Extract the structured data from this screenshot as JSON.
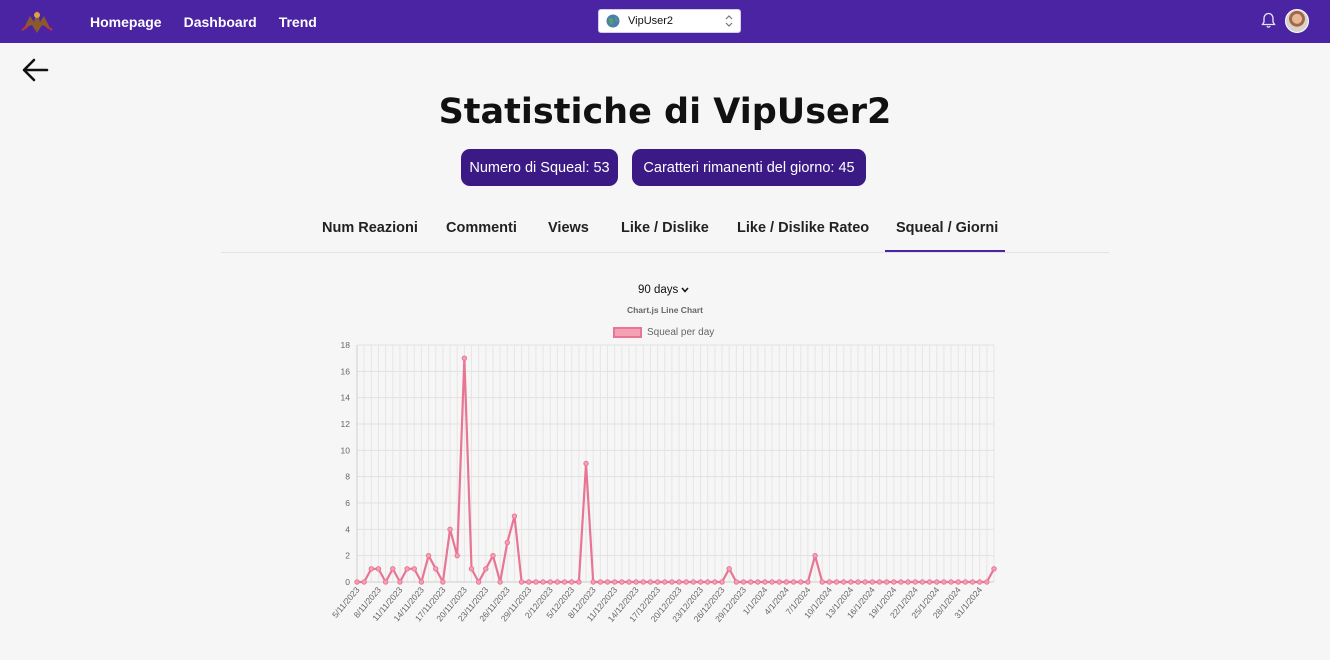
{
  "nav": {
    "links": [
      "Homepage",
      "Dashboard",
      "Trend"
    ],
    "selected_user": "VipUser2"
  },
  "page": {
    "title": "Statistiche di VipUser2",
    "squeal_count_label": "Numero di Squeal: 53",
    "chars_remaining_label": "Caratteri rimanenti del giorno: 45"
  },
  "tabs": [
    {
      "label": "Num Reazioni",
      "active": false
    },
    {
      "label": "Commenti",
      "active": false
    },
    {
      "label": "Views",
      "active": false
    },
    {
      "label": "Like / Dislike",
      "active": false
    },
    {
      "label": "Like / Dislike Rateo",
      "active": false
    },
    {
      "label": "Squeal / Giorni",
      "active": true
    }
  ],
  "chart_controls": {
    "period": "90 days"
  },
  "colors": {
    "navbar": "#4a24a3",
    "pill": "#3b1a86",
    "line": "#e97595"
  },
  "chart_data": {
    "type": "line",
    "title": "Chart.js Line Chart",
    "series": [
      {
        "name": "Squeal per day",
        "values": [
          0,
          0,
          1,
          1,
          0,
          1,
          0,
          1,
          1,
          0,
          2,
          1,
          0,
          4,
          2,
          17,
          1,
          0,
          1,
          2,
          0,
          3,
          5,
          0,
          0,
          0,
          0,
          0,
          0,
          0,
          0,
          0,
          9,
          0,
          0,
          0,
          0,
          0,
          0,
          0,
          0,
          0,
          0,
          0,
          0,
          0,
          0,
          0,
          0,
          0,
          0,
          0,
          1,
          0,
          0,
          0,
          0,
          0,
          0,
          0,
          0,
          0,
          0,
          0,
          2,
          0,
          0,
          0,
          0,
          0,
          0,
          0,
          0,
          0,
          0,
          0,
          0,
          0,
          0,
          0,
          0,
          0,
          0,
          0,
          0,
          0,
          0,
          0,
          0,
          1
        ]
      }
    ],
    "x_labels": [
      "5/11/2023",
      "8/11/2023",
      "11/11/2023",
      "14/11/2023",
      "17/11/2023",
      "20/11/2023",
      "23/11/2023",
      "26/11/2023",
      "29/11/2023",
      "2/12/2023",
      "5/12/2023",
      "8/12/2023",
      "11/12/2023",
      "14/12/2023",
      "17/12/2023",
      "20/12/2023",
      "23/12/2023",
      "26/12/2023",
      "29/12/2023",
      "1/1/2024",
      "4/1/2024",
      "7/1/2024",
      "10/1/2024",
      "13/1/2024",
      "16/1/2024",
      "19/1/2024",
      "22/1/2024",
      "25/1/2024",
      "28/1/2024",
      "31/1/2024"
    ],
    "y_ticks": [
      "0",
      "2",
      "4",
      "6",
      "8",
      "10",
      "12",
      "14",
      "16",
      "18"
    ],
    "ylim": [
      0,
      18
    ],
    "grid": true,
    "legend_position": "top"
  }
}
